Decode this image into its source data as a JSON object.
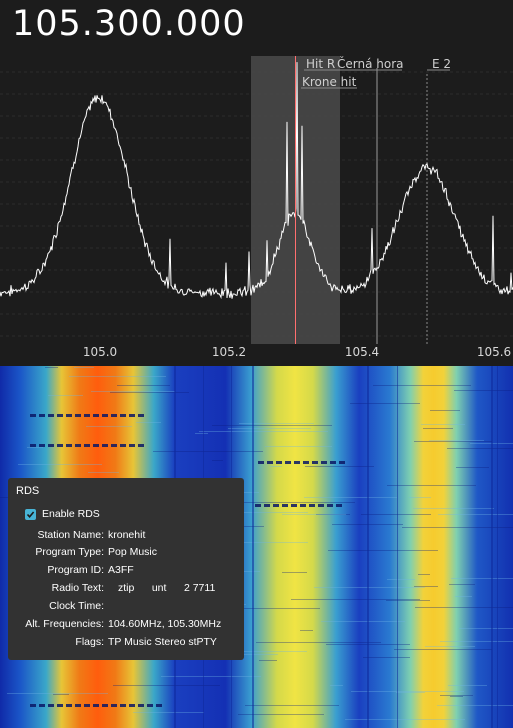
{
  "frequency_display": "105.300.000",
  "axis_ticks": [
    "105.0",
    "105.2",
    "105.4",
    "105.6"
  ],
  "station_labels": {
    "hit_r": "Hit R",
    "cerna_hora": "Černá hora",
    "krone_hit": "Krone hit",
    "e2": "E 2"
  },
  "rds": {
    "title": "RDS",
    "enable_label": "Enable RDS",
    "enabled": true,
    "fields": [
      {
        "label": "Station Name:",
        "value": "kronehit"
      },
      {
        "label": "Program Type:",
        "value": "Pop Music"
      },
      {
        "label": "Program ID:",
        "value": "A3FF"
      },
      {
        "label": "Radio Text:",
        "value": "ztip      unt      2 7711"
      },
      {
        "label": "Clock Time:",
        "value": ""
      },
      {
        "label": "Alt. Frequencies:",
        "value": "104.60MHz, 105.30MHz"
      },
      {
        "label": "Flags:",
        "value": "TP Music Stereo stPTY"
      }
    ]
  },
  "colors": {
    "background": "#1c1c1c",
    "spectrum_line": "#ffffff",
    "tuning_line": "#ff6f6f",
    "bandwidth_shade": "#4a4a4a",
    "checkbox_accent": "#48b4d6"
  }
}
